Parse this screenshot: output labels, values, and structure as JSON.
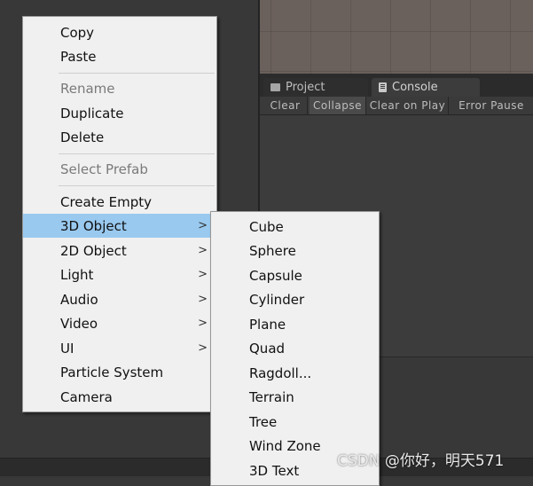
{
  "tabs": {
    "project": {
      "label": "Project",
      "icon": "folder-icon"
    },
    "console": {
      "label": "Console",
      "icon": "console-icon"
    }
  },
  "console_toolbar": {
    "clear": "Clear",
    "collapse": "Collapse",
    "clear_on_play": "Clear on Play",
    "error_pause": "Error Pause"
  },
  "context_menu": {
    "items": [
      {
        "label": "Copy",
        "enabled": true
      },
      {
        "label": "Paste",
        "enabled": true
      },
      {
        "label": "Rename",
        "enabled": false
      },
      {
        "label": "Duplicate",
        "enabled": true
      },
      {
        "label": "Delete",
        "enabled": true
      },
      {
        "label": "Select Prefab",
        "enabled": false
      },
      {
        "label": "Create Empty",
        "enabled": true
      },
      {
        "label": "3D Object",
        "enabled": true,
        "submenu": true,
        "highlighted": true
      },
      {
        "label": "2D Object",
        "enabled": true,
        "submenu": true
      },
      {
        "label": "Light",
        "enabled": true,
        "submenu": true
      },
      {
        "label": "Audio",
        "enabled": true,
        "submenu": true
      },
      {
        "label": "Video",
        "enabled": true,
        "submenu": true
      },
      {
        "label": "UI",
        "enabled": true,
        "submenu": true
      },
      {
        "label": "Particle System",
        "enabled": true
      },
      {
        "label": "Camera",
        "enabled": true
      }
    ],
    "submenu_arrow": ">"
  },
  "submenu_3d_object": {
    "items": [
      "Cube",
      "Sphere",
      "Capsule",
      "Cylinder",
      "Plane",
      "Quad",
      "Ragdoll...",
      "Terrain",
      "Tree",
      "Wind Zone",
      "3D Text"
    ]
  },
  "watermark": "CSDN @你好，明天571",
  "colors": {
    "menu_bg": "#f0f0f0",
    "menu_highlight": "#99c9ef",
    "editor_bg": "#383838"
  }
}
